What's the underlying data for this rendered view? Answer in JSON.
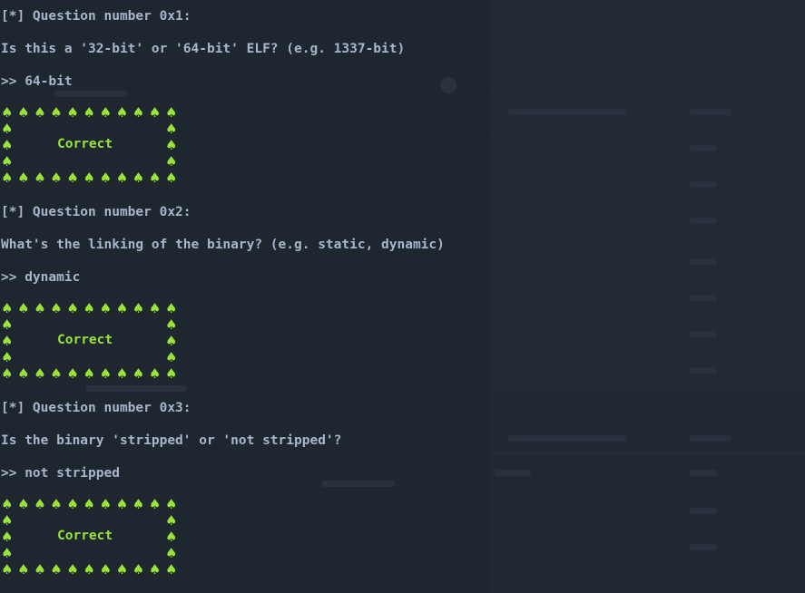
{
  "theme": {
    "background": "#1e2630",
    "text": "#a6b6cb",
    "accent_green": "#9be33a"
  },
  "questions": [
    {
      "header": "[*] Question number 0x1:",
      "prompt": "Is this a '32-bit' or '64-bit' ELF? (e.g. 1337-bit)",
      "answer": ">> 64-bit",
      "result": "Correct"
    },
    {
      "header": "[*] Question number 0x2:",
      "prompt": "What's the linking of the binary? (e.g. static, dynamic)",
      "answer": ">> dynamic",
      "result": "Correct"
    },
    {
      "header": "[*] Question number 0x3:",
      "prompt": "Is the binary 'stripped' or 'not stripped'?",
      "answer": ">> not stripped",
      "result": "Correct"
    }
  ],
  "box_glyph": "♠",
  "icons": [
    "spade-icon"
  ]
}
